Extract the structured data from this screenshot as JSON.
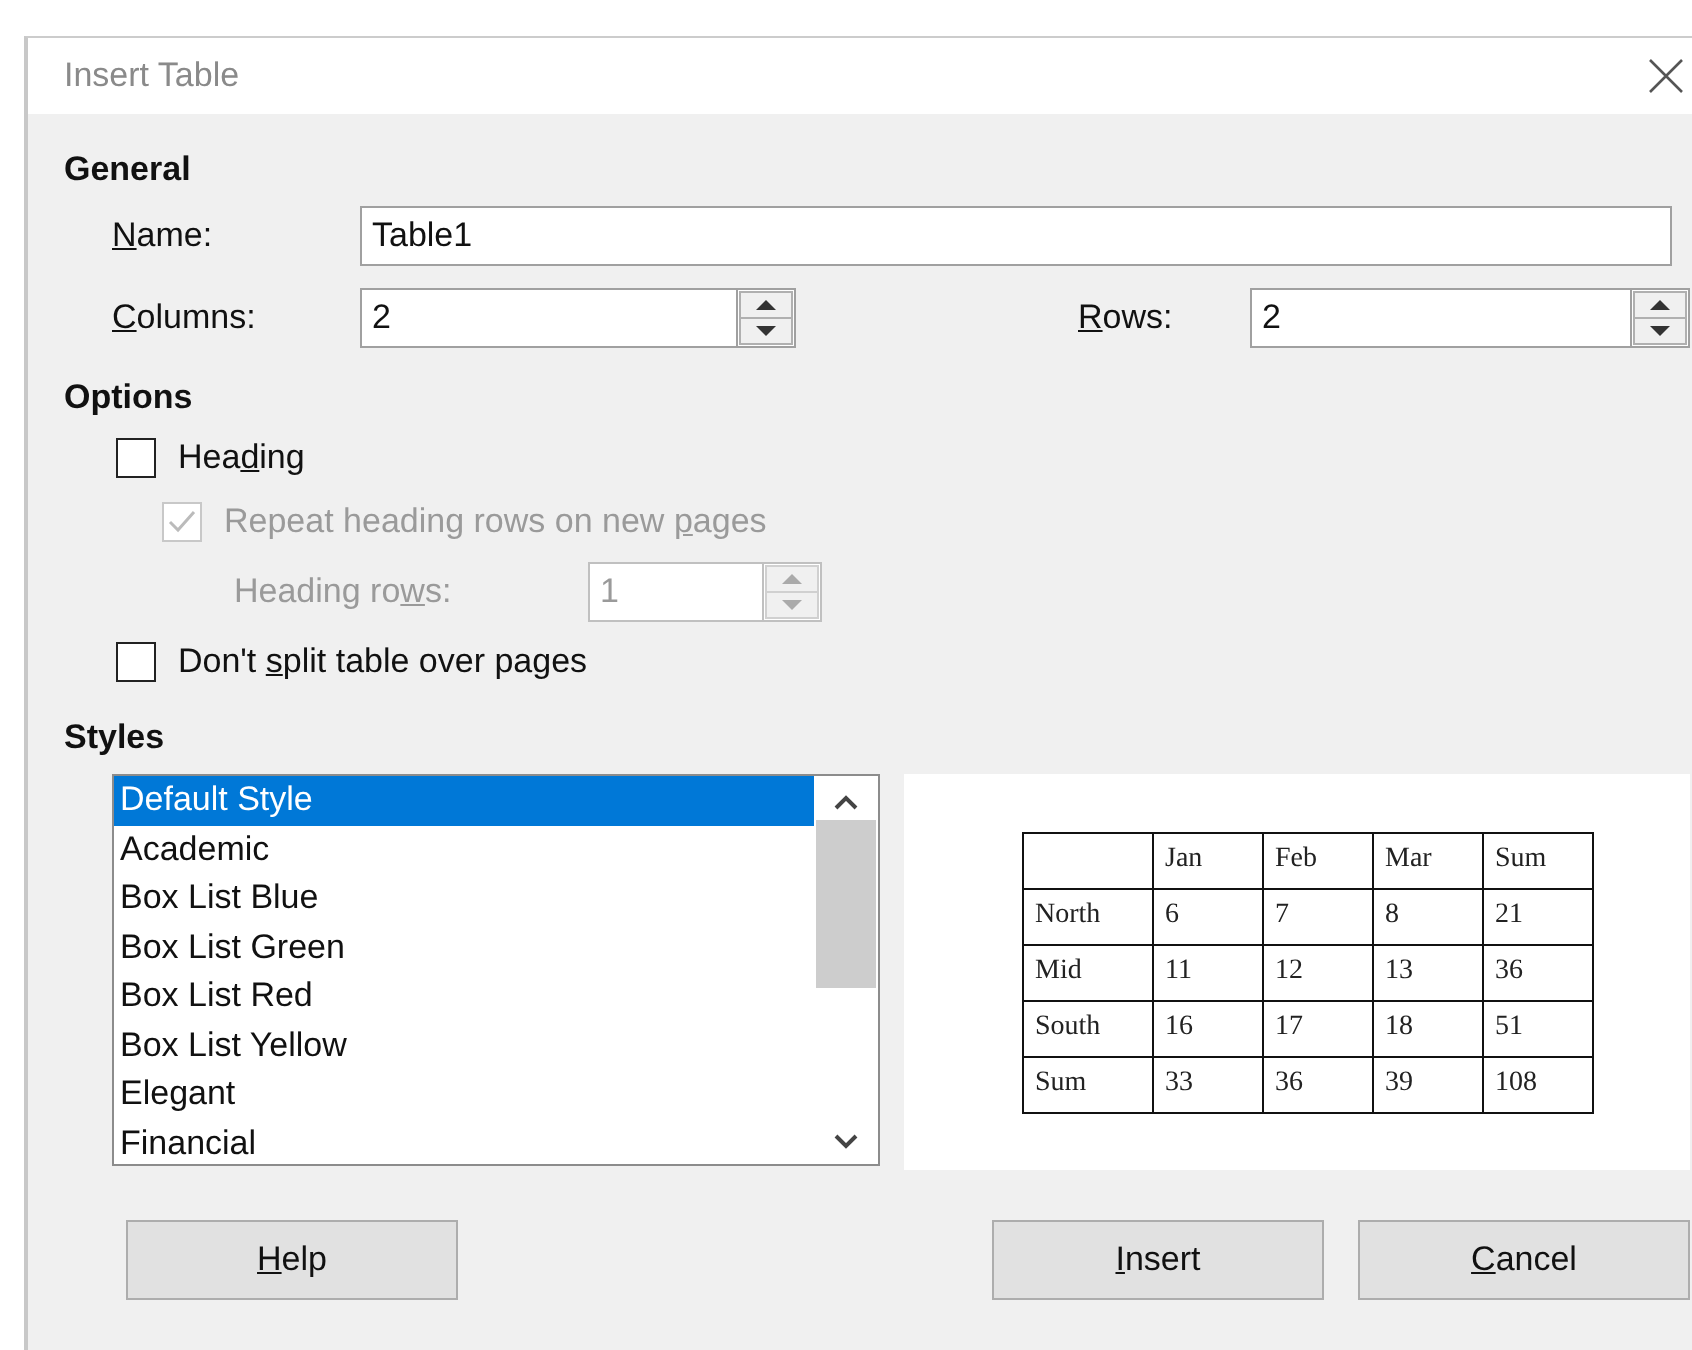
{
  "window": {
    "title": "Insert Table"
  },
  "general": {
    "heading": "General",
    "name": {
      "label": {
        "key": "N",
        "post": "ame:"
      },
      "value": "Table1"
    },
    "columns": {
      "label": {
        "key": "C",
        "post": "olumns:"
      },
      "value": "2"
    },
    "rows": {
      "label": {
        "key": "R",
        "post": "ows:"
      },
      "value": "2"
    }
  },
  "options": {
    "heading": "Options",
    "heading_checkbox": {
      "label": {
        "pre": "Hea",
        "key": "d",
        "post": "ing"
      },
      "checked": false,
      "disabled": false
    },
    "repeat_checkbox": {
      "label": {
        "pre": "Repeat heading rows on new ",
        "key": "p",
        "post": "ages"
      },
      "checked": true,
      "disabled": true
    },
    "heading_rows": {
      "label": {
        "pre": "Heading ro",
        "key": "w",
        "post": "s:"
      },
      "value": "1",
      "disabled": true
    },
    "split_checkbox": {
      "label": {
        "pre": "Don't ",
        "key": "s",
        "post": "plit table over pages"
      },
      "checked": false,
      "disabled": false
    }
  },
  "styles": {
    "heading": "Styles",
    "items": [
      {
        "label": "Default Style",
        "selected": true
      },
      {
        "label": "Academic",
        "selected": false
      },
      {
        "label": "Box List Blue",
        "selected": false
      },
      {
        "label": "Box List Green",
        "selected": false
      },
      {
        "label": "Box List Red",
        "selected": false
      },
      {
        "label": "Box List Yellow",
        "selected": false
      },
      {
        "label": "Elegant",
        "selected": false
      },
      {
        "label": "Financial",
        "selected": false
      }
    ],
    "preview": {
      "columns": [
        "Jan",
        "Feb",
        "Mar",
        "Sum"
      ],
      "rows": [
        {
          "label": "North",
          "cells": [
            "6",
            "7",
            "8",
            "21"
          ]
        },
        {
          "label": "Mid",
          "cells": [
            "11",
            "12",
            "13",
            "36"
          ]
        },
        {
          "label": "South",
          "cells": [
            "16",
            "17",
            "18",
            "51"
          ]
        },
        {
          "label": "Sum",
          "cells": [
            "33",
            "36",
            "39",
            "108"
          ]
        }
      ]
    }
  },
  "buttons": [
    {
      "label": {
        "key": "H",
        "post": "elp"
      }
    },
    {
      "label": {
        "key": "I",
        "post": "nsert"
      }
    },
    {
      "label": {
        "key": "C",
        "post": "ancel"
      }
    }
  ]
}
